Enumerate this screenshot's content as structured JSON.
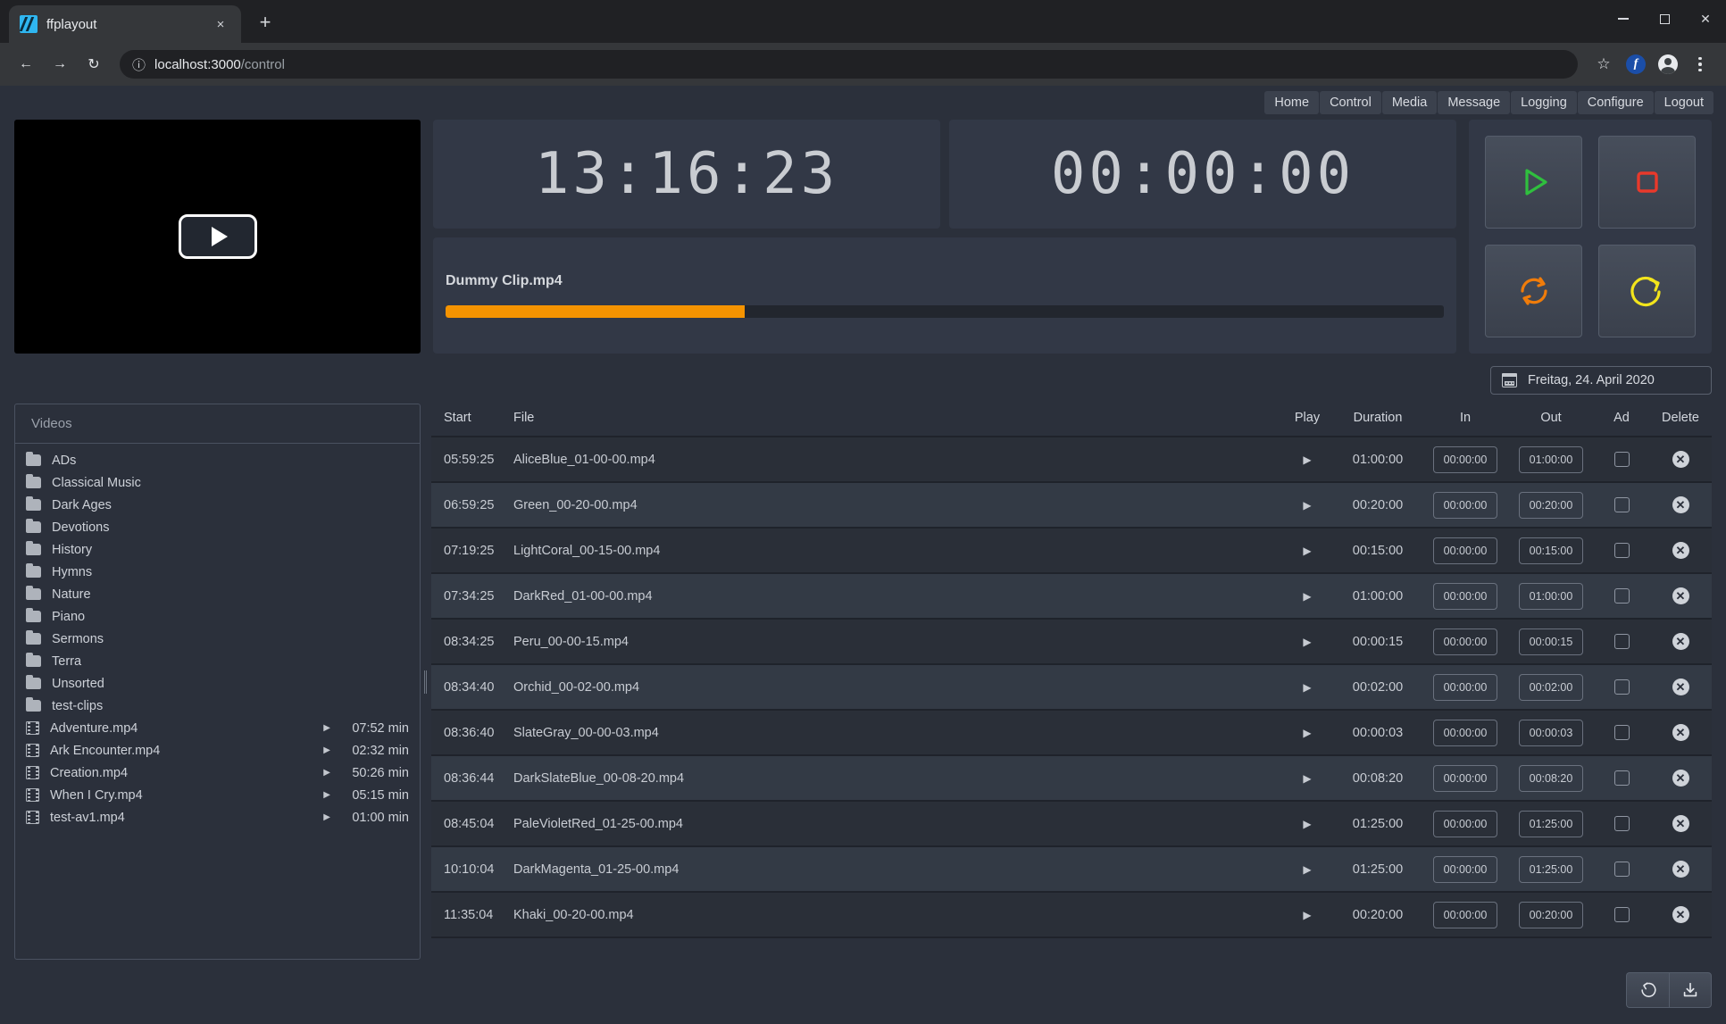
{
  "browser": {
    "tab_title": "ffplayout",
    "tab_close_label": "×",
    "new_tab_label": "+",
    "back_icon": "←",
    "forward_icon": "→",
    "reload_icon": "↻",
    "info_icon": "ⓘ",
    "url_host": "localhost:3000",
    "url_path": "/control",
    "bookmark_icon": "☆",
    "extension_letter": "f",
    "minimize_label": "",
    "maximize_label": "",
    "close_label": "✕"
  },
  "nav": {
    "items": [
      {
        "label": "Home"
      },
      {
        "label": "Control"
      },
      {
        "label": "Media"
      },
      {
        "label": "Message"
      },
      {
        "label": "Logging"
      },
      {
        "label": "Configure"
      },
      {
        "label": "Logout"
      }
    ]
  },
  "player": {
    "play_overlay_icon": "play-triangle"
  },
  "clocks": {
    "current_time": "13:16:23",
    "remaining_time": "00:00:00"
  },
  "clip": {
    "name": "Dummy Clip.mp4",
    "progress_percent": 30,
    "progress_color": "#f59300"
  },
  "controls": {
    "play": {
      "name": "start-playout",
      "color": "#2fbf3e"
    },
    "stop": {
      "name": "stop-playout",
      "color": "#e8392b"
    },
    "sync": {
      "name": "reset-playout",
      "color": "#f07c0a"
    },
    "restart": {
      "name": "restart-playout",
      "color": "#f2e41c"
    }
  },
  "date_picker": {
    "value": "Freitag, 24. April 2020"
  },
  "sidebar": {
    "header": "Videos",
    "items": [
      {
        "type": "folder",
        "name": "ADs",
        "duration": ""
      },
      {
        "type": "folder",
        "name": "Classical Music",
        "duration": ""
      },
      {
        "type": "folder",
        "name": "Dark Ages",
        "duration": ""
      },
      {
        "type": "folder",
        "name": "Devotions",
        "duration": ""
      },
      {
        "type": "folder",
        "name": "History",
        "duration": ""
      },
      {
        "type": "folder",
        "name": "Hymns",
        "duration": ""
      },
      {
        "type": "folder",
        "name": "Nature",
        "duration": ""
      },
      {
        "type": "folder",
        "name": "Piano",
        "duration": ""
      },
      {
        "type": "folder",
        "name": "Sermons",
        "duration": ""
      },
      {
        "type": "folder",
        "name": "Terra",
        "duration": ""
      },
      {
        "type": "folder",
        "name": "Unsorted",
        "duration": ""
      },
      {
        "type": "folder",
        "name": "test-clips",
        "duration": ""
      },
      {
        "type": "file",
        "name": "Adventure.mp4",
        "duration": "07:52 min"
      },
      {
        "type": "file",
        "name": "Ark Encounter.mp4",
        "duration": "02:32 min"
      },
      {
        "type": "file",
        "name": "Creation.mp4",
        "duration": "50:26 min"
      },
      {
        "type": "file",
        "name": "When I Cry.mp4",
        "duration": "05:15 min"
      },
      {
        "type": "file",
        "name": "test-av1.mp4",
        "duration": "01:00 min"
      }
    ]
  },
  "playlist": {
    "columns": [
      "Start",
      "File",
      "Play",
      "Duration",
      "In",
      "Out",
      "Ad",
      "Delete"
    ],
    "rows": [
      {
        "start": "05:59:25",
        "file": "AliceBlue_01-00-00.mp4",
        "duration": "01:00:00",
        "in": "00:00:00",
        "out": "01:00:00",
        "ad": false
      },
      {
        "start": "06:59:25",
        "file": "Green_00-20-00.mp4",
        "duration": "00:20:00",
        "in": "00:00:00",
        "out": "00:20:00",
        "ad": false
      },
      {
        "start": "07:19:25",
        "file": "LightCoral_00-15-00.mp4",
        "duration": "00:15:00",
        "in": "00:00:00",
        "out": "00:15:00",
        "ad": false
      },
      {
        "start": "07:34:25",
        "file": "DarkRed_01-00-00.mp4",
        "duration": "01:00:00",
        "in": "00:00:00",
        "out": "01:00:00",
        "ad": false
      },
      {
        "start": "08:34:25",
        "file": "Peru_00-00-15.mp4",
        "duration": "00:00:15",
        "in": "00:00:00",
        "out": "00:00:15",
        "ad": false
      },
      {
        "start": "08:34:40",
        "file": "Orchid_00-02-00.mp4",
        "duration": "00:02:00",
        "in": "00:00:00",
        "out": "00:02:00",
        "ad": false
      },
      {
        "start": "08:36:40",
        "file": "SlateGray_00-00-03.mp4",
        "duration": "00:00:03",
        "in": "00:00:00",
        "out": "00:00:03",
        "ad": false
      },
      {
        "start": "08:36:44",
        "file": "DarkSlateBlue_00-08-20.mp4",
        "duration": "00:08:20",
        "in": "00:00:00",
        "out": "00:08:20",
        "ad": false
      },
      {
        "start": "08:45:04",
        "file": "PaleVioletRed_01-25-00.mp4",
        "duration": "01:25:00",
        "in": "00:00:00",
        "out": "01:25:00",
        "ad": false
      },
      {
        "start": "10:10:04",
        "file": "DarkMagenta_01-25-00.mp4",
        "duration": "01:25:00",
        "in": "00:00:00",
        "out": "01:25:00",
        "ad": false
      },
      {
        "start": "11:35:04",
        "file": "Khaki_00-20-00.mp4",
        "duration": "00:20:00",
        "in": "00:00:00",
        "out": "00:20:00",
        "ad": false
      }
    ],
    "row_play_icon": "▶",
    "delete_icon": "✕"
  },
  "footer": {
    "reload_icon": "reset-playlist-icon",
    "save_icon": "save-playlist-icon"
  }
}
